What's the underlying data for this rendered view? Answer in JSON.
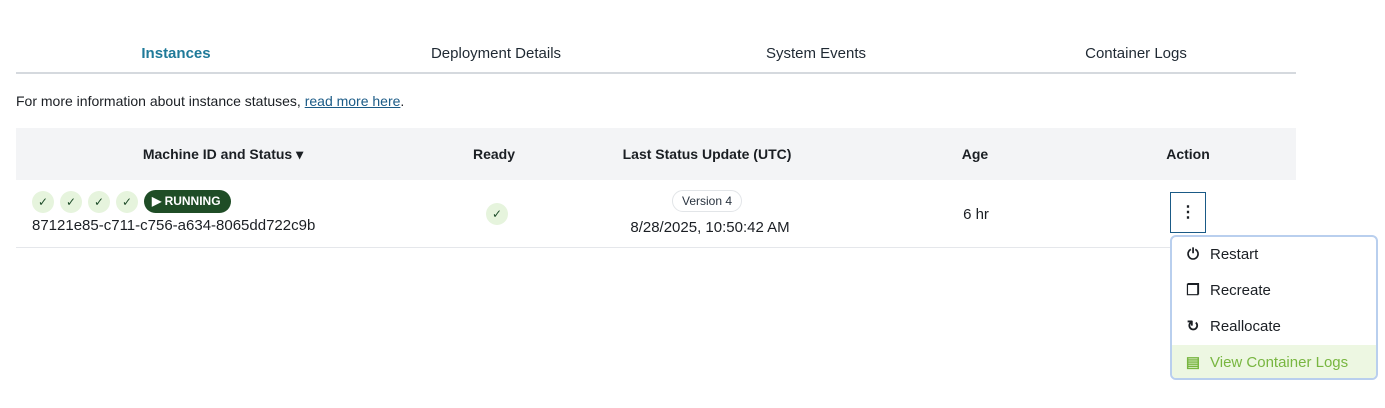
{
  "tabs": [
    {
      "label": "Instances"
    },
    {
      "label": "Deployment Details"
    },
    {
      "label": "System Events"
    },
    {
      "label": "Container Logs"
    }
  ],
  "info": {
    "text": "For more information about instance statuses, ",
    "link": "read more here",
    "end": "."
  },
  "table": {
    "headers": [
      "Machine ID and Status ▾",
      "Ready",
      "Last Status Update (UTC)",
      "Age",
      "Action"
    ],
    "row": {
      "status": "RUNNING",
      "machine_id": "87121e85-c711-c756-a634-8065dd722c9b",
      "version": "Version 4",
      "last_update": "8/28/2025, 10:50:42 AM",
      "age": "6 hr"
    }
  },
  "menu": {
    "items": [
      {
        "label": "Restart",
        "icon": "power-icon"
      },
      {
        "label": "Recreate",
        "icon": "copy-icon"
      },
      {
        "label": "Reallocate",
        "icon": "refresh-icon"
      },
      {
        "label": "View Container Logs",
        "icon": "file-icon"
      }
    ]
  }
}
